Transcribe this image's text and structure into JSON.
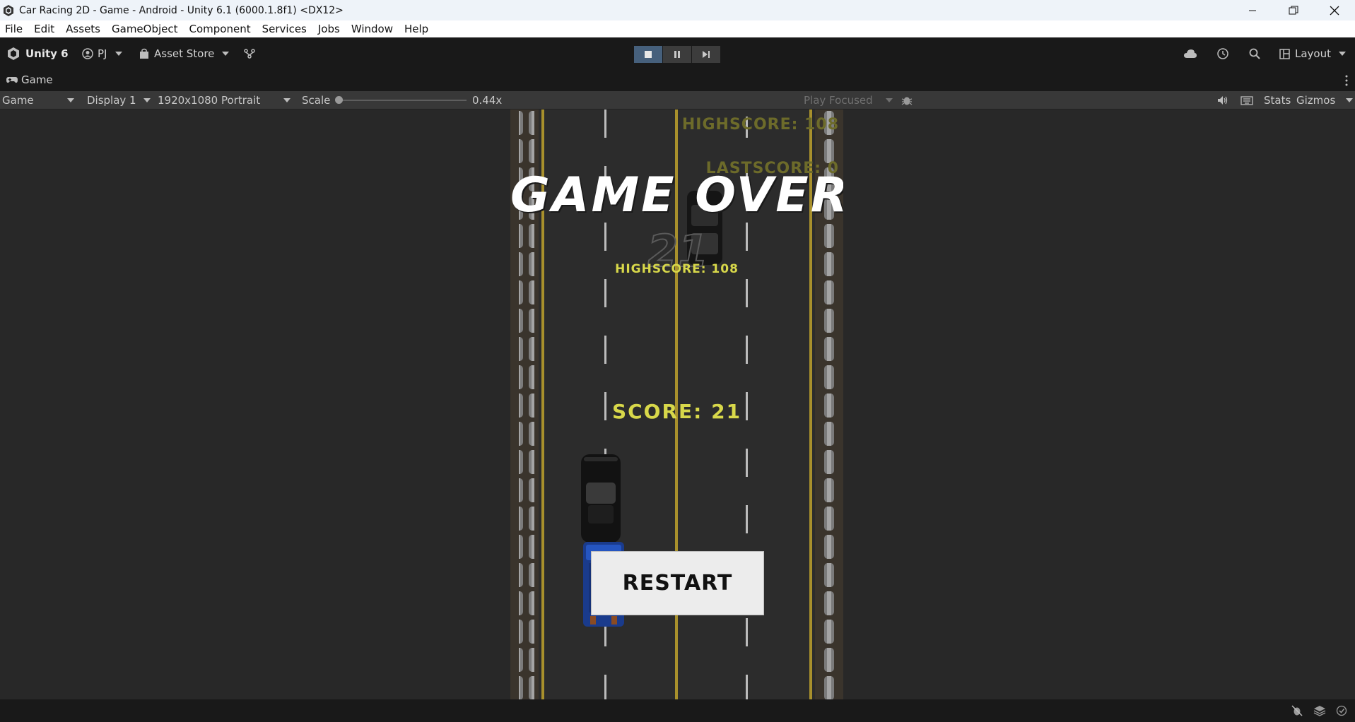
{
  "window": {
    "title": "Car Racing 2D - Game - Android - Unity 6.1 (6000.1.8f1) <DX12>",
    "controls": [
      "minimize-icon",
      "restore-icon",
      "close-icon"
    ]
  },
  "menu": {
    "items": [
      "File",
      "Edit",
      "Assets",
      "GameObject",
      "Component",
      "Services",
      "Jobs",
      "Window",
      "Help"
    ]
  },
  "toolbar": {
    "unity_label": "Unity 6",
    "account_label": "PJ",
    "asset_store_label": "Asset Store",
    "layout_label": "Layout",
    "play_state": "playing"
  },
  "tab": {
    "label": "Game"
  },
  "gamebar": {
    "view_mode": "Game",
    "display": "Display 1",
    "resolution": "1920x1080 Portrait",
    "scale_label": "Scale",
    "scale_value": "0.44x",
    "play_mode": "Play Focused",
    "stats_label": "Stats",
    "gizmos_label": "Gizmos"
  },
  "game": {
    "hud_highscore": "HIGHSCORE: 108",
    "hud_lastscore": "LASTSCORE: 0",
    "game_over": "GAME OVER",
    "big_score": "21",
    "panel_highscore": "HIGHSCORE: 108",
    "score": "SCORE: 21",
    "restart": "RESTART"
  },
  "colors": {
    "accent_yellow": "#d8d84a",
    "dim_yellow": "#6d6b2a",
    "road": "#2a2a2a",
    "lane_yellow": "#a8902c",
    "play_active": "#46607c"
  }
}
